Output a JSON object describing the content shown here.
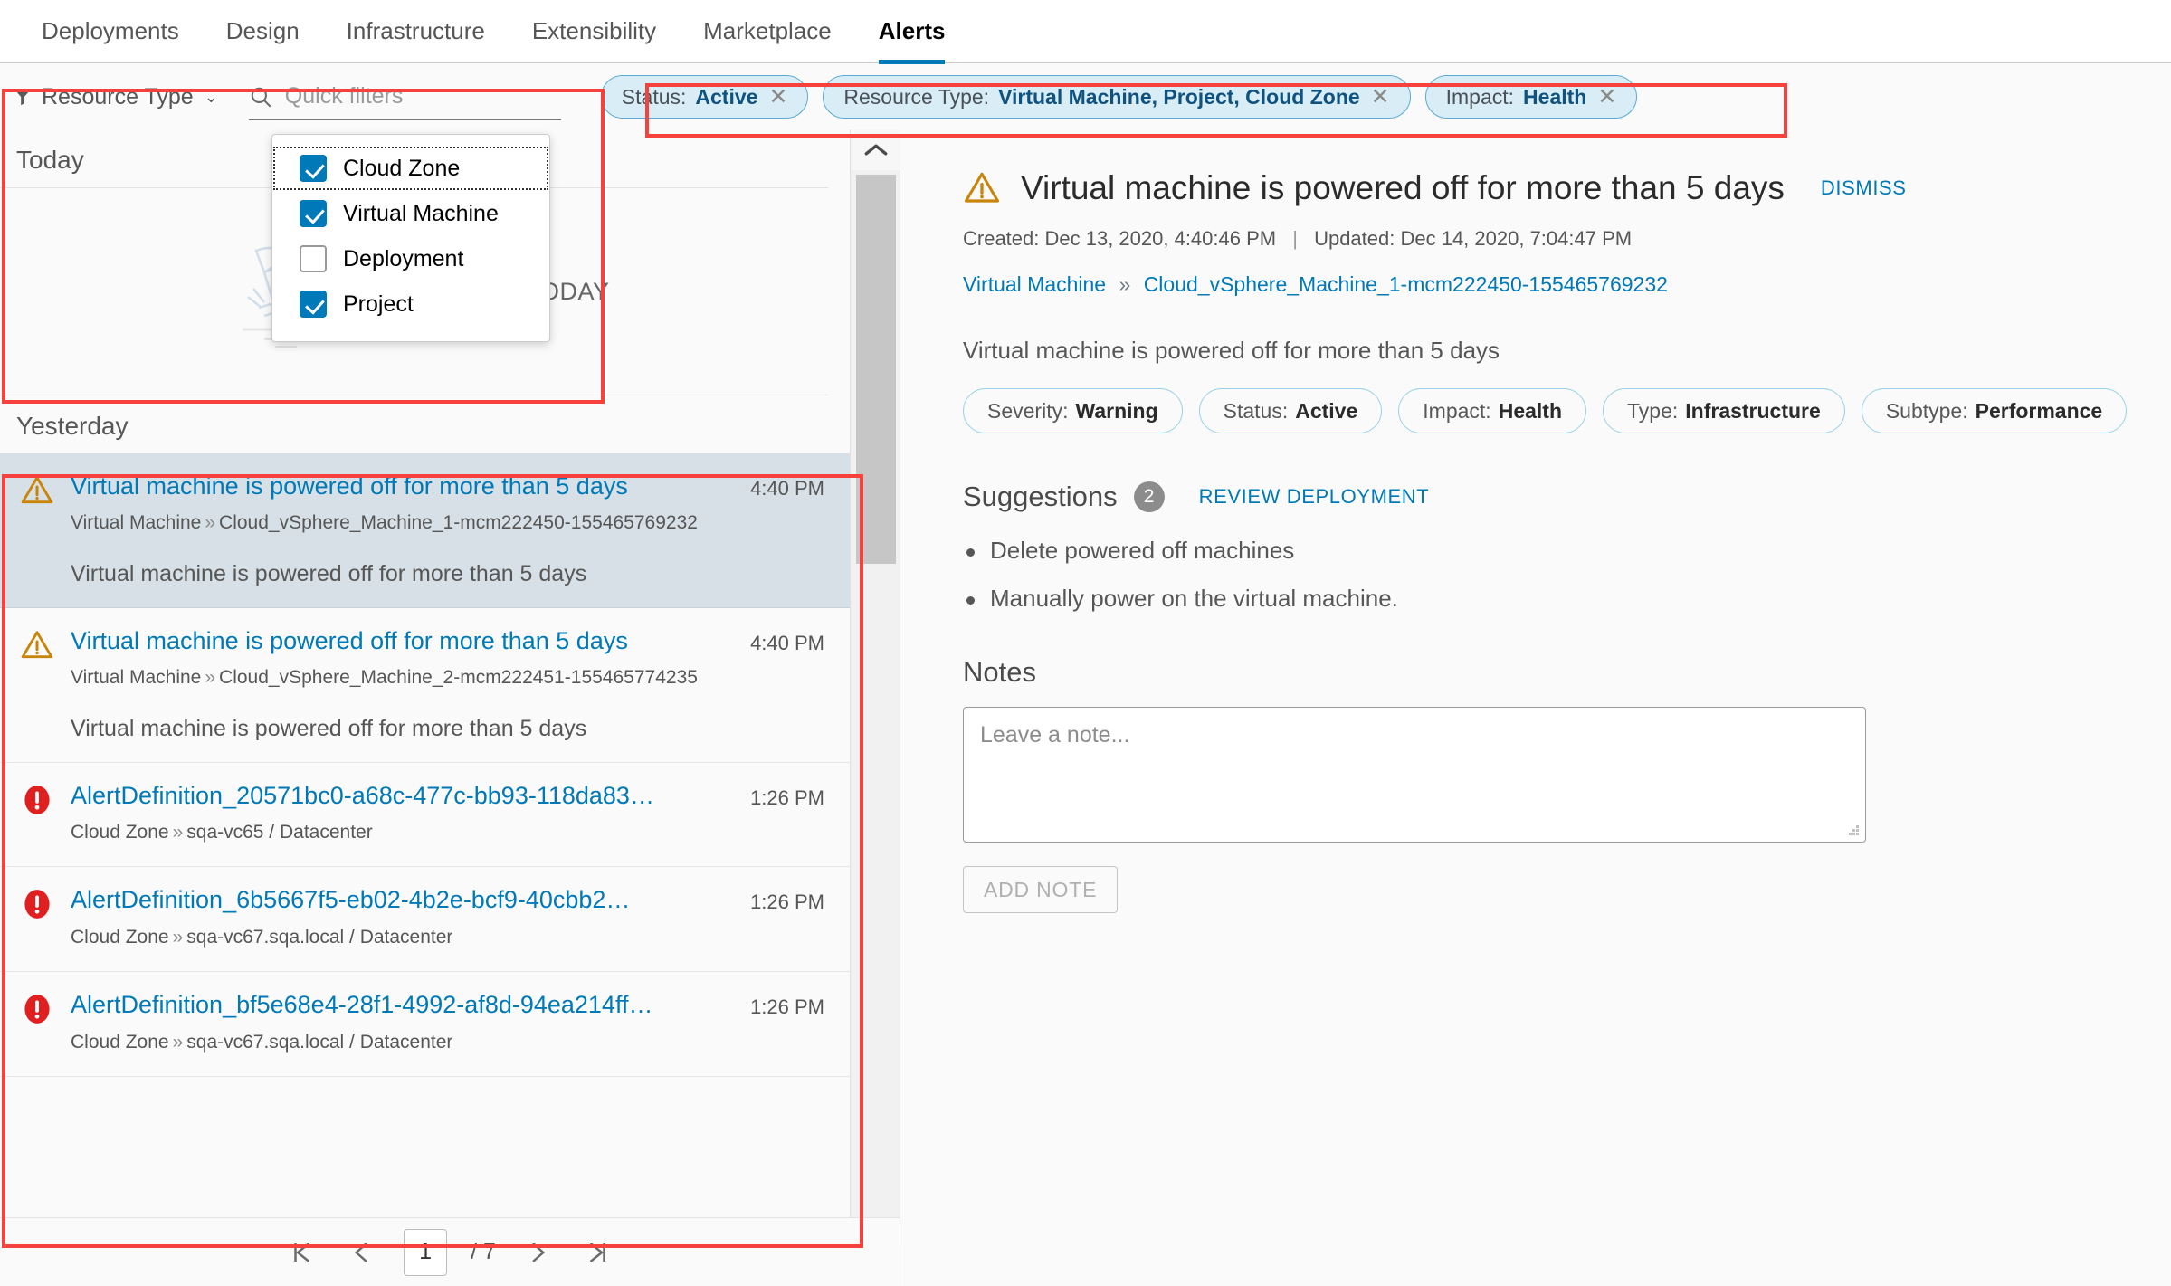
{
  "nav": {
    "items": [
      {
        "label": "Deployments",
        "active": false
      },
      {
        "label": "Design",
        "active": false
      },
      {
        "label": "Infrastructure",
        "active": false
      },
      {
        "label": "Extensibility",
        "active": false
      },
      {
        "label": "Marketplace",
        "active": false
      },
      {
        "label": "Alerts",
        "active": true
      }
    ]
  },
  "filterbar": {
    "resource_type_label": "Resource Type",
    "caret": "⌄",
    "quick_filters_placeholder": "Quick filters",
    "quick_filters_value": "",
    "chips": [
      {
        "key": "Status:",
        "value": "Active",
        "close": "✕"
      },
      {
        "key": "Resource Type:",
        "value": "Virtual Machine, Project, Cloud Zone",
        "close": "✕"
      },
      {
        "key": "Impact:",
        "value": "Health",
        "close": "✕"
      }
    ]
  },
  "dropdown": {
    "options": [
      {
        "label": "Cloud Zone",
        "checked": true,
        "focused": true
      },
      {
        "label": "Virtual Machine",
        "checked": true,
        "focused": false
      },
      {
        "label": "Deployment",
        "checked": false,
        "focused": false
      },
      {
        "label": "Project",
        "checked": true,
        "focused": false
      }
    ]
  },
  "list": {
    "groups": [
      {
        "title": "Today",
        "empty_text": "NO ALERTS TODAY"
      },
      {
        "title": "Yesterday"
      }
    ],
    "alerts": [
      {
        "severity": "warning",
        "title": "Virtual machine is powered off for more than 5 days",
        "time": "4:40 PM",
        "path_type": "Virtual Machine",
        "path_sep": "»",
        "path_name": "Cloud_vSphere_Machine_1-mcm222450-155465769232",
        "description": "Virtual machine is powered off for more than 5 days",
        "selected": true
      },
      {
        "severity": "warning",
        "title": "Virtual machine is powered off for more than 5 days",
        "time": "4:40 PM",
        "path_type": "Virtual Machine",
        "path_sep": "»",
        "path_name": "Cloud_vSphere_Machine_2-mcm222451-155465774235",
        "description": "Virtual machine is powered off for more than 5 days",
        "selected": false
      },
      {
        "severity": "critical",
        "title": "AlertDefinition_20571bc0-a68c-477c-bb93-118da83…",
        "time": "1:26 PM",
        "path_type": "Cloud Zone",
        "path_sep": "»",
        "path_name": "sqa-vc65 / Datacenter",
        "description": "",
        "selected": false
      },
      {
        "severity": "critical",
        "title": "AlertDefinition_6b5667f5-eb02-4b2e-bcf9-40cbb2…",
        "time": "1:26 PM",
        "path_type": "Cloud Zone",
        "path_sep": "»",
        "path_name": "sqa-vc67.sqa.local / Datacenter",
        "description": "",
        "selected": false
      },
      {
        "severity": "critical",
        "title": "AlertDefinition_bf5e68e4-28f1-4992-af8d-94ea214ff…",
        "time": "1:26 PM",
        "path_type": "Cloud Zone",
        "path_sep": "»",
        "path_name": "sqa-vc67.sqa.local / Datacenter",
        "description": "",
        "selected": false
      }
    ]
  },
  "pagination": {
    "current_page": "1",
    "total_label": "/ 7",
    "first_label": "first-page",
    "prev_label": "previous-page",
    "next_label": "next-page",
    "last_label": "last-page"
  },
  "detail": {
    "title": "Virtual machine is powered off for more than 5 days",
    "dismiss_label": "DISMISS",
    "created_label": "Created: Dec 13, 2020, 4:40:46 PM",
    "divider": "|",
    "updated_label": "Updated: Dec 14, 2020, 7:04:47 PM",
    "breadcrumb_type": "Virtual Machine",
    "breadcrumb_sep": "»",
    "breadcrumb_name": "Cloud_vSphere_Machine_1-mcm222450-155465769232",
    "description": "Virtual machine is powered off for more than 5 days",
    "chips": [
      {
        "key": "Severity:",
        "value": "Warning"
      },
      {
        "key": "Status:",
        "value": "Active"
      },
      {
        "key": "Impact:",
        "value": "Health"
      },
      {
        "key": "Type:",
        "value": "Infrastructure"
      },
      {
        "key": "Subtype:",
        "value": "Performance"
      }
    ],
    "suggestions_title": "Suggestions",
    "suggestions_count": "2",
    "review_label": "REVIEW DEPLOYMENT",
    "suggestions": [
      "Delete powered off machines",
      "Manually power on the virtual machine."
    ],
    "notes_title": "Notes",
    "notes_placeholder": "Leave a note...",
    "notes_value": "",
    "add_note_label": "ADD NOTE"
  },
  "colors": {
    "accent": "#0079b8",
    "warning": "#c8850a",
    "critical": "#e02020",
    "chip_bg": "#d9edf7",
    "annotation": "#f6413c",
    "selected_row": "#d6e0e6"
  }
}
